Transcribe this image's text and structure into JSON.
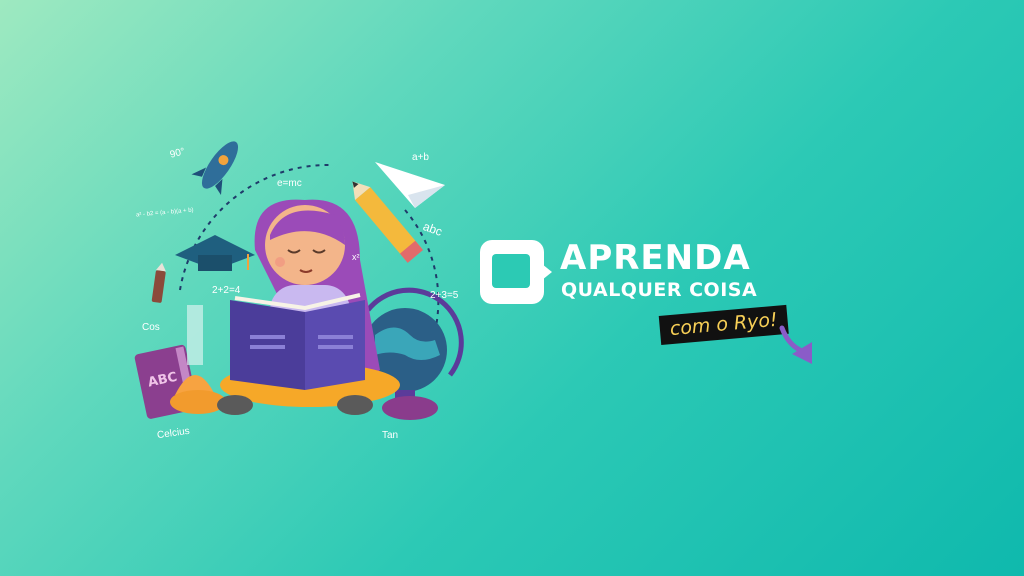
{
  "brand": {
    "title_line1": "APRENDA",
    "title_line2": "QUALQUER COISA",
    "tagline": "com o Ryo!"
  },
  "illustration": {
    "formulas": [
      "90°",
      "e=mc",
      "a+b",
      "abc",
      "a² - b2 = (a - b)(a + b)",
      "x²",
      "2+2=4",
      "2+3=5",
      "Cos",
      "Celcius",
      "Tan"
    ],
    "book_label": "ABC"
  },
  "colors": {
    "background_start": "#9ee9c0",
    "background_end": "#0fb9ad",
    "tagline_bg": "#111111",
    "tagline_text": "#f7cf56",
    "hair": "#9b4bb8",
    "book": "#4b3d9a",
    "arrow": "#8a5cc8"
  }
}
